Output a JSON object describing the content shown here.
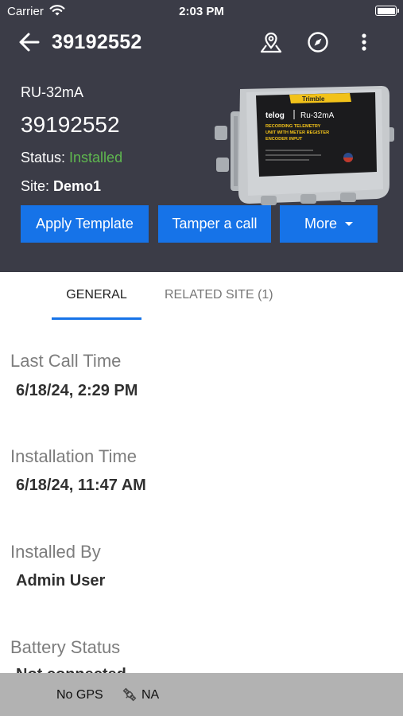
{
  "status_bar": {
    "carrier": "Carrier",
    "time": "2:03 PM"
  },
  "nav": {
    "title": "39192552",
    "icons": [
      "back-arrow-icon",
      "map-pin-icon",
      "compass-icon",
      "more-vert-icon"
    ]
  },
  "device": {
    "model": "RU-32mA",
    "serial": "39192552",
    "status_label": "Status: ",
    "status_value": "Installed",
    "site_label": "Site: ",
    "site_value": "Demo1",
    "image": {
      "brand": "Trimble",
      "logo": "telog",
      "model_text": "Ru-32mA",
      "description": "RECORDING TELEMETRY UNIT WITH METER REGISTER ENCODER INPUT"
    }
  },
  "actions": {
    "apply_template": "Apply Template",
    "tamper_call": "Tamper a call",
    "more": "More"
  },
  "tabs": [
    {
      "label": "GENERAL",
      "active": true
    },
    {
      "label": "RELATED SITE (1)",
      "active": false
    }
  ],
  "fields": [
    {
      "label": "Last Call Time",
      "value": "6/18/24, 2:29 PM"
    },
    {
      "label": "Installation Time",
      "value": "6/18/24, 11:47 AM"
    },
    {
      "label": "Installed By",
      "value": "Admin User"
    },
    {
      "label": "Battery Status",
      "value": "Not connected"
    }
  ],
  "footer": {
    "gps": "No GPS",
    "satellite": "NA"
  },
  "colors": {
    "header_bg": "#3b3c47",
    "accent": "#1673e8",
    "status_ok": "#5fb84f",
    "footer_bg": "#b2b2b2"
  }
}
